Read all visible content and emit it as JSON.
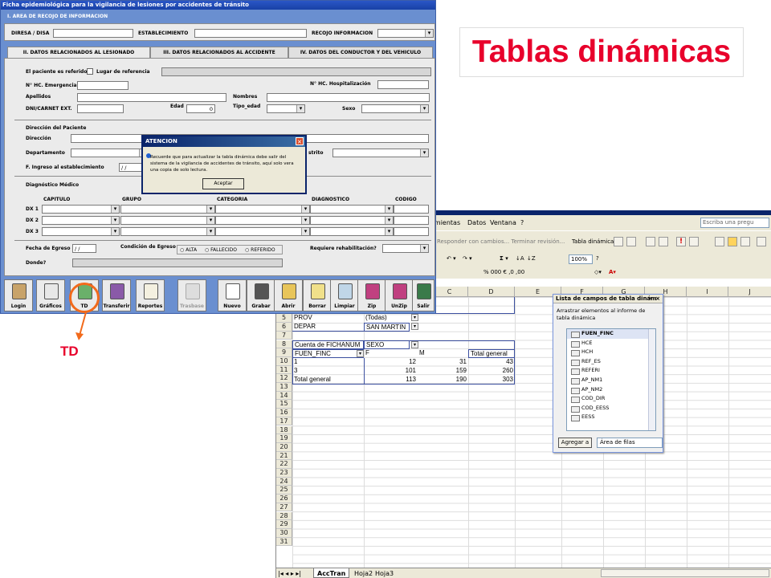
{
  "slide_title": "Tablas dinámicas",
  "callout_label": "TD",
  "access": {
    "window_title": "Ficha epidemiológica para la vigilancia de lesiones por accidentes de tránsito",
    "section_header": "I. AREA DE RECOJO DE INFORMACION",
    "fields_top": {
      "diresa": "DIRESA / DISA",
      "establecimiento": "ESTABLECIMIENTO",
      "recojo": "RECOJO INFORMACION"
    },
    "tabs": [
      "II. DATOS RELACIONADOS AL LESIONADO",
      "III. DATOS RELACIONADOS AL ACCIDENTE",
      "IV. DATOS DEL CONDUCTOR Y DEL VEHICULO"
    ],
    "labels": {
      "referido": "El paciente es referido",
      "lugar_ref": "Lugar de referencia",
      "nhc_emerg": "N° HC. Emergencia",
      "nhc_hosp": "N° HC. Hospitalización",
      "apellidos": "Apellidos",
      "nombres": "Nombres",
      "dni": "DNI/CARNET EXT.",
      "edad": "Edad",
      "tipo_edad": "Tipo_edad",
      "sexo": "Sexo",
      "dir_paciente": "Dirección del Paciente",
      "direccion": "Dirección",
      "departamento": "Departamento",
      "distrito": "strito",
      "fingreso": "F. Ingreso al establecimiento",
      "diag": "Diagnóstico Médico",
      "capitulo": "CAPITULO",
      "grupo": "GRUPO",
      "categoria": "CATEGORIA",
      "diagnostico": "DIAGNOSTICO",
      "codigo": "CODIGO",
      "dx1": "DX 1",
      "dx2": "DX 2",
      "dx3": "DX 3",
      "fegreso": "Fecha de Egreso",
      "condicion": "Condición de Egreso",
      "alta": "ALTA",
      "fallecido": "FALLECIDO",
      "referido2": "REFERIDO",
      "rehab": "Requiere rehabilitación?",
      "donde": "Donde?"
    },
    "values": {
      "edad": "0",
      "fingreso": "/ /",
      "fegreso": "/ /"
    },
    "dialog": {
      "title": "ATENCION",
      "message": "Recuerde que para actualizar la tabla dinámica debe salir del sistema de la vigilancia de accidentes de tránsito, aquí solo vera una copia de solo lectura.",
      "ok": "Aceptar"
    },
    "toolbar": [
      "Login",
      "Gráficos",
      "TD",
      "Transferir",
      "Reportes",
      "Trasbase",
      "Nuevo",
      "Grabar",
      "Abrir",
      "Borrar",
      "Limpiar",
      "Zip",
      "UnZip",
      "Salir"
    ]
  },
  "excel": {
    "menu": [
      "amientas",
      "Datos",
      "Ventana",
      "?"
    ],
    "menu_hint": "Escriba una pregu",
    "review_toolbar": "Responder con cambios...  Terminar revisión...",
    "pivot_toolbar": "Tabla dinámica ▾",
    "zoom": "100%",
    "columns": [
      "C",
      "D",
      "E",
      "F",
      "G",
      "H",
      "I",
      "J"
    ],
    "rows": [
      "3",
      "4",
      "5",
      "6",
      "7",
      "8",
      "9",
      "10",
      "11",
      "12",
      "13",
      "14",
      "15",
      "16",
      "17",
      "18",
      "19",
      "20",
      "21",
      "22",
      "23",
      "24",
      "25",
      "26",
      "27",
      "28",
      "29",
      "30",
      "31"
    ],
    "pivot": {
      "prov_label": "PROV",
      "prov_value": "(Todas)",
      "depar_label": "DEPAR",
      "depar_value": "SAN MARTIN",
      "data_field": "Cuenta de FICHANUM",
      "col_field": "SEXO",
      "row_field": "FUEN_FINC",
      "col_f": "F",
      "col_m": "M",
      "col_total": "Total general",
      "rows": [
        {
          "label": "1",
          "f": "12",
          "m": "31",
          "total": "43"
        },
        {
          "label": "3",
          "f": "101",
          "m": "159",
          "total": "260"
        },
        {
          "label": "Total general",
          "f": "113",
          "m": "190",
          "total": "303"
        }
      ]
    },
    "sheets": [
      "AccTran",
      "Hoja2",
      "Hoja3"
    ],
    "field_list": {
      "title": "Lista de campos de tabla dinám",
      "instructions": "Arrastrar elementos al informe de tabla dinámica",
      "fields": [
        "FUEN_FINC",
        "HCE",
        "HCH",
        "REF_ES",
        "REFERI",
        "AP_NM1",
        "AP_NM2",
        "COD_DIR",
        "COD_EESS",
        "EESS"
      ],
      "add_button": "Agregar a",
      "area": "Área de filas"
    }
  }
}
